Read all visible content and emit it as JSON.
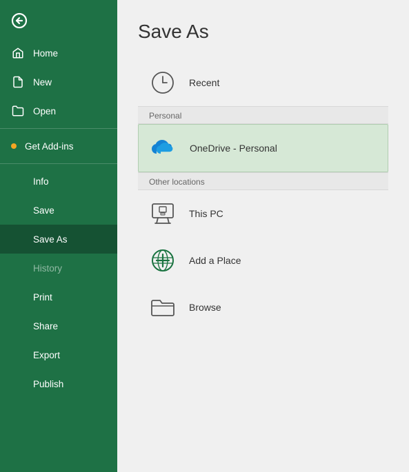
{
  "sidebar": {
    "back_label": "Back",
    "items": [
      {
        "id": "home",
        "label": "Home",
        "icon": "home-icon",
        "active": false,
        "disabled": false
      },
      {
        "id": "new",
        "label": "New",
        "icon": "new-icon",
        "active": false,
        "disabled": false
      },
      {
        "id": "open",
        "label": "Open",
        "icon": "open-icon",
        "active": false,
        "disabled": false
      },
      {
        "id": "get-add-ins",
        "label": "Get Add-ins",
        "icon": "dot-icon",
        "active": false,
        "disabled": false
      },
      {
        "id": "info",
        "label": "Info",
        "icon": "none",
        "active": false,
        "disabled": false
      },
      {
        "id": "save",
        "label": "Save",
        "icon": "none",
        "active": false,
        "disabled": false
      },
      {
        "id": "save-as",
        "label": "Save As",
        "icon": "none",
        "active": true,
        "disabled": false
      },
      {
        "id": "history",
        "label": "History",
        "icon": "none",
        "active": false,
        "disabled": true
      },
      {
        "id": "print",
        "label": "Print",
        "icon": "none",
        "active": false,
        "disabled": false
      },
      {
        "id": "share",
        "label": "Share",
        "icon": "none",
        "active": false,
        "disabled": false
      },
      {
        "id": "export",
        "label": "Export",
        "icon": "none",
        "active": false,
        "disabled": false
      },
      {
        "id": "publish",
        "label": "Publish",
        "icon": "none",
        "active": false,
        "disabled": false
      }
    ]
  },
  "main": {
    "title": "Save As",
    "recent_label": "Recent",
    "personal_section": "Personal",
    "onedrive_label": "OneDrive - Personal",
    "other_locations_section": "Other locations",
    "this_pc_label": "This PC",
    "add_place_label": "Add a Place",
    "browse_label": "Browse"
  }
}
